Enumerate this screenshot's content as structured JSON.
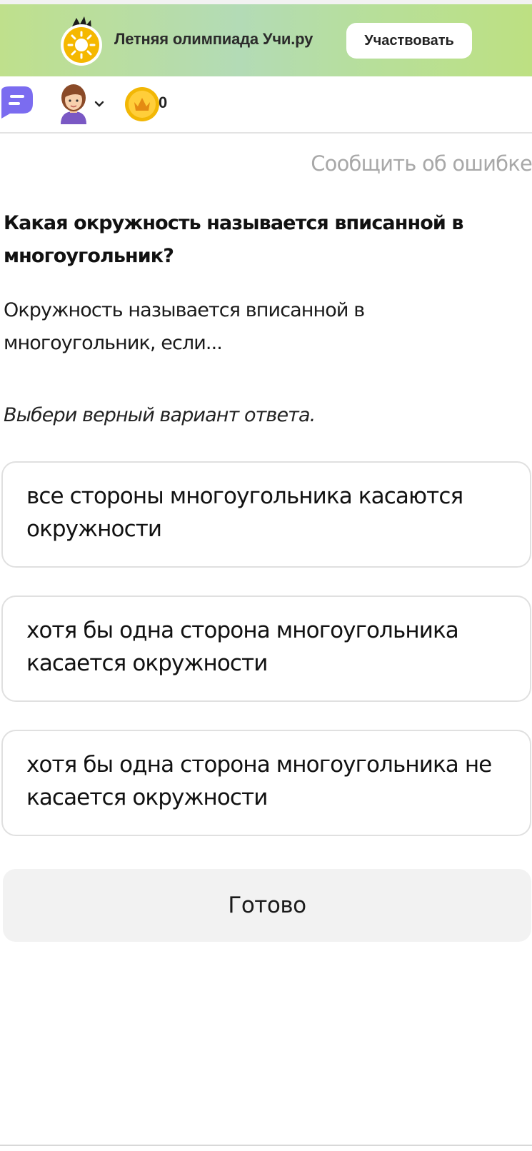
{
  "banner": {
    "title": "Летняя олимпиада Учи.ру",
    "button_label": "Участвовать",
    "icon": "sun-crown-icon"
  },
  "toolbar": {
    "chat_icon": "chat-bubble-icon",
    "avatar_icon": "user-avatar-icon",
    "dropdown_icon": "chevron-down-icon",
    "coin_icon": "coin-icon",
    "coin_count": "0"
  },
  "report_link": "Сообщить об ошибке",
  "question": {
    "title": "Какая окружность называется вписанной в многоугольник?",
    "description": "Окружность называется вписанной в многоугольник, если...",
    "instruction": "Выбери верный вариант ответа."
  },
  "options": [
    {
      "label": "все стороны многоугольника касаются окружности"
    },
    {
      "label": "хотя бы одна сторона многоугольника касается окружности"
    },
    {
      "label": "хотя бы одна сторона многоугольника не касается окружности"
    }
  ],
  "done_button": "Готово",
  "colors": {
    "banner_gradient_start": "#bfe08c",
    "banner_gradient_mid": "#b3dbb6",
    "accent_purple": "#7b6cf0",
    "coin_gold": "#f2b705",
    "button_gray": "#f2f2f2",
    "muted_text": "#a8a8a8"
  }
}
